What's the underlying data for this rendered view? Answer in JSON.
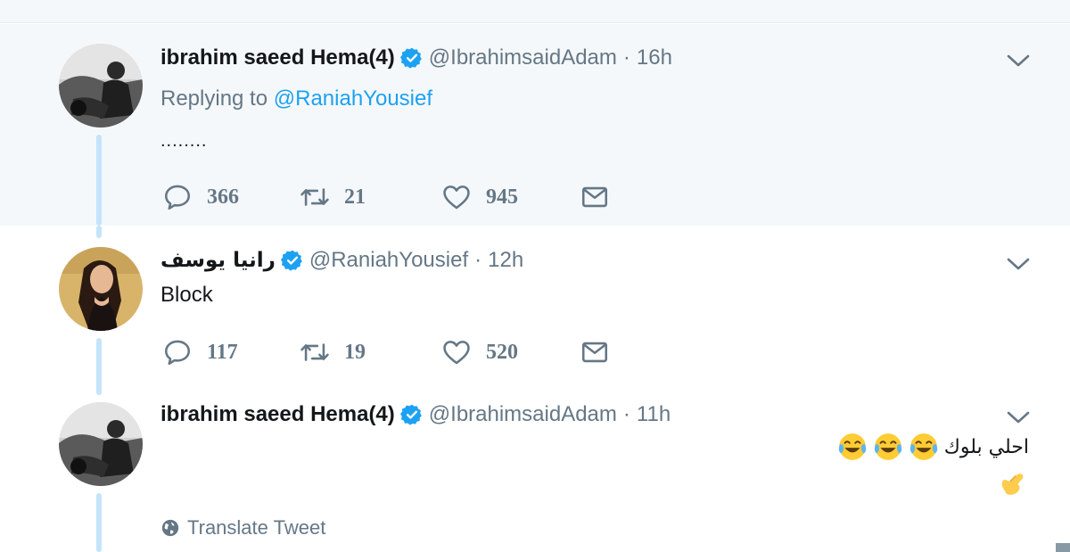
{
  "tweets": [
    {
      "name": "ibrahim saeed Hema(4)",
      "handle": "@IbrahimsaidAdam",
      "separator": "·",
      "time": "16h",
      "replying_prefix": "Replying to",
      "replying_to": "@RaniahYousief",
      "text": "........",
      "replies": "366",
      "retweets": "21",
      "likes": "945",
      "icons": [
        "reply-icon",
        "retweet-icon",
        "like-icon",
        "message-icon",
        "verified-icon",
        "chevron-down-icon"
      ]
    },
    {
      "name": "رانيا يوسف",
      "handle": "@RaniahYousief",
      "separator": "·",
      "time": "12h",
      "text": "Block",
      "replies": "117",
      "retweets": "19",
      "likes": "520"
    },
    {
      "name": "ibrahim saeed Hema(4)",
      "handle": "@IbrahimsaidAdam",
      "separator": "·",
      "time": "11h",
      "text": "احلي بلوك",
      "translate_label": "Translate Tweet",
      "icons": [
        "face-tears-of-joy-icon",
        "call-me-hand-icon",
        "globe-icon"
      ]
    }
  ],
  "colors": {
    "highlight_bg": "#f5f8fa",
    "link": "#1da1f2",
    "secondary_text": "#657786",
    "thread_line": "#c4e4fb"
  }
}
